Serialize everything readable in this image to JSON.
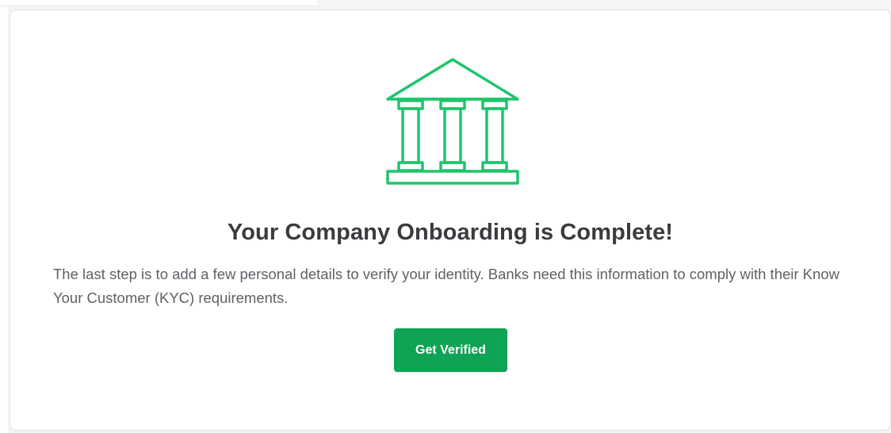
{
  "card": {
    "icon": "bank-icon",
    "title": "Your Company Onboarding is Complete!",
    "description": "The last step is to add a few personal details to verify your identity. Banks need this information to comply with their Know Your Customer (KYC) requirements.",
    "button_label": "Get Verified"
  },
  "colors": {
    "accent": "#0fa356",
    "icon_stroke": "#1ec56b",
    "title_text": "#3a3b3f",
    "body_text": "#5f6166"
  }
}
